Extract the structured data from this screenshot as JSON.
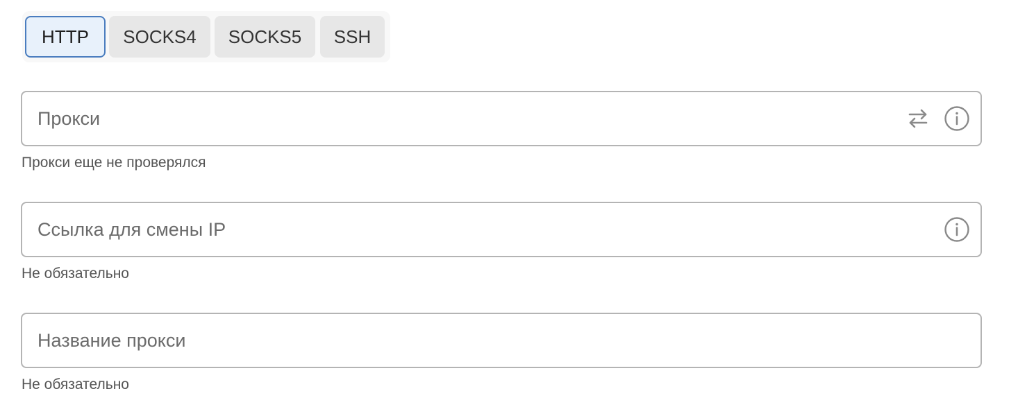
{
  "proxy_types": {
    "active": "HTTP",
    "tabs": [
      {
        "label": "HTTP"
      },
      {
        "label": "SOCKS4"
      },
      {
        "label": "SOCKS5"
      },
      {
        "label": "SSH"
      }
    ]
  },
  "fields": {
    "proxy": {
      "value": "",
      "placeholder": "Прокси",
      "hint": "Прокси еще не проверялся",
      "icons": [
        "swap-arrows-icon",
        "info-icon"
      ]
    },
    "ip_change_link": {
      "value": "",
      "placeholder": "Ссылка для смены IP",
      "hint": "Не обязательно",
      "icons": [
        "info-icon"
      ]
    },
    "proxy_name": {
      "value": "",
      "placeholder": "Название прокси",
      "hint": "Не обязательно",
      "icons": []
    }
  },
  "colors": {
    "active_tab_border": "#4a7dbf",
    "active_tab_bg": "#e8f1fb",
    "tab_bg": "#e7e7e7",
    "field_border": "#b4b4b4",
    "icon_color": "#8a8a8a"
  }
}
